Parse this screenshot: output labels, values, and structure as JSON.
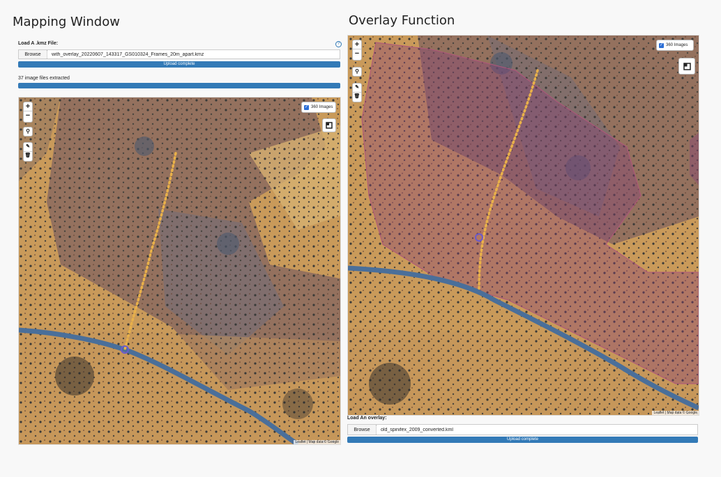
{
  "left": {
    "heading": "Mapping Window",
    "load_label": "Load A .kmz File:",
    "browse_label": "Browse",
    "filename": "with_overlay_20220607_143317_GS010324_Frames_20m_apart.kmz",
    "upload_status": "Upload complete",
    "extracted_text": "37 image files extracted",
    "toggle_label": "360 Images",
    "attribution": "Leaflet | Map data © Google"
  },
  "right": {
    "heading": "Overlay Function",
    "toggle_label": "360 Images",
    "attribution": "Leaflet | Map data © Google",
    "load_label": "Load An overlay:",
    "browse_label": "Browse",
    "filename": "old_spinifex_2009_converted.kml",
    "upload_status": "Upload complete"
  },
  "controls": {
    "zoom_in": "+",
    "zoom_out": "−"
  },
  "colors": {
    "accent": "#337ab7",
    "overlay": "#8a3f7a",
    "track": "#e8b04a",
    "road": "#4a6f9a"
  }
}
